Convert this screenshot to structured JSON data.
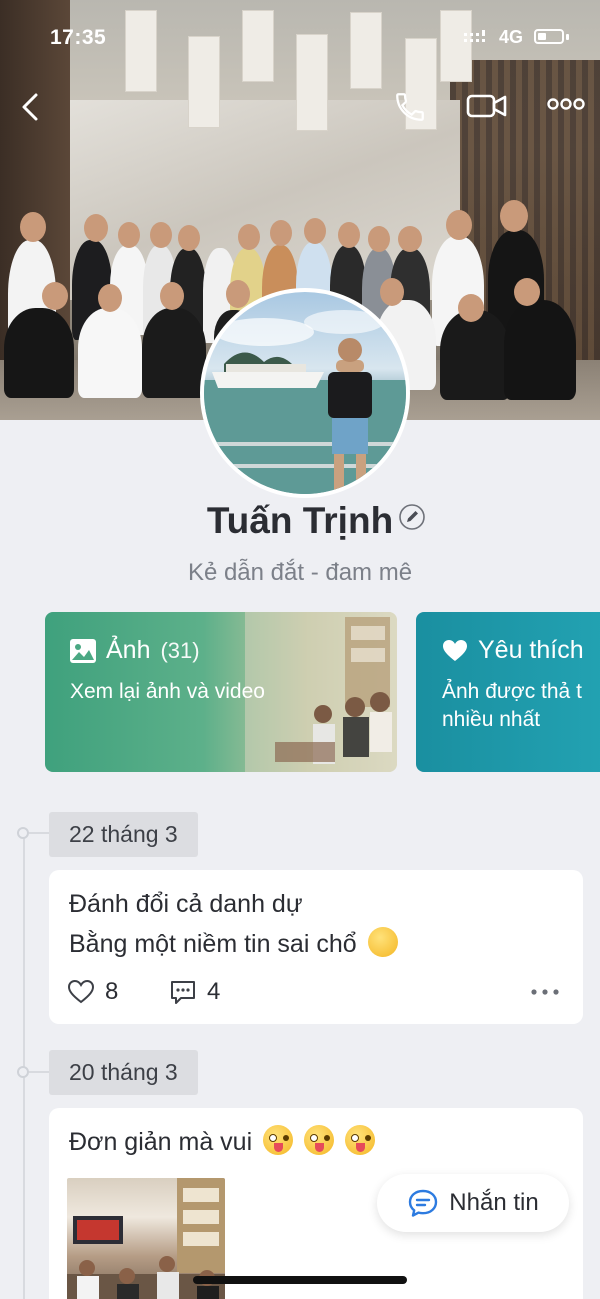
{
  "status_bar": {
    "time": "17:35",
    "network": "4G"
  },
  "profile": {
    "name": "Tuấn Trịnh",
    "bio": "Kẻ dẫn đắt - đam mê"
  },
  "cards": {
    "photos": {
      "title": "Ảnh",
      "count": "(31)",
      "subtitle": "Xem lại ảnh và video"
    },
    "favorites": {
      "title": "Yêu thích",
      "subtitle_line1": "Ảnh được thả t",
      "subtitle_line2": "nhiều nhất"
    }
  },
  "timeline": [
    {
      "date": "22 tháng 3",
      "text_line1": "Đánh đổi cả danh dự",
      "text_line2": "Bằng một niềm tin sai chổ",
      "likes": "8",
      "comments": "4"
    },
    {
      "date": "20 tháng 3",
      "text_line1": "Đơn giản mà vui"
    }
  ],
  "message_button": {
    "label": "Nhắn tin"
  },
  "colors": {
    "photo_card": "#3fa17d",
    "favorite_card": "#1a8fa0",
    "message_icon": "#2d7be0",
    "background": "#eeeff3"
  },
  "icons": [
    "back-icon",
    "phone-icon",
    "video-call-icon",
    "more-options-icon",
    "edit-icon",
    "image-icon",
    "heart-icon",
    "like-icon",
    "comment-icon",
    "message-icon"
  ]
}
